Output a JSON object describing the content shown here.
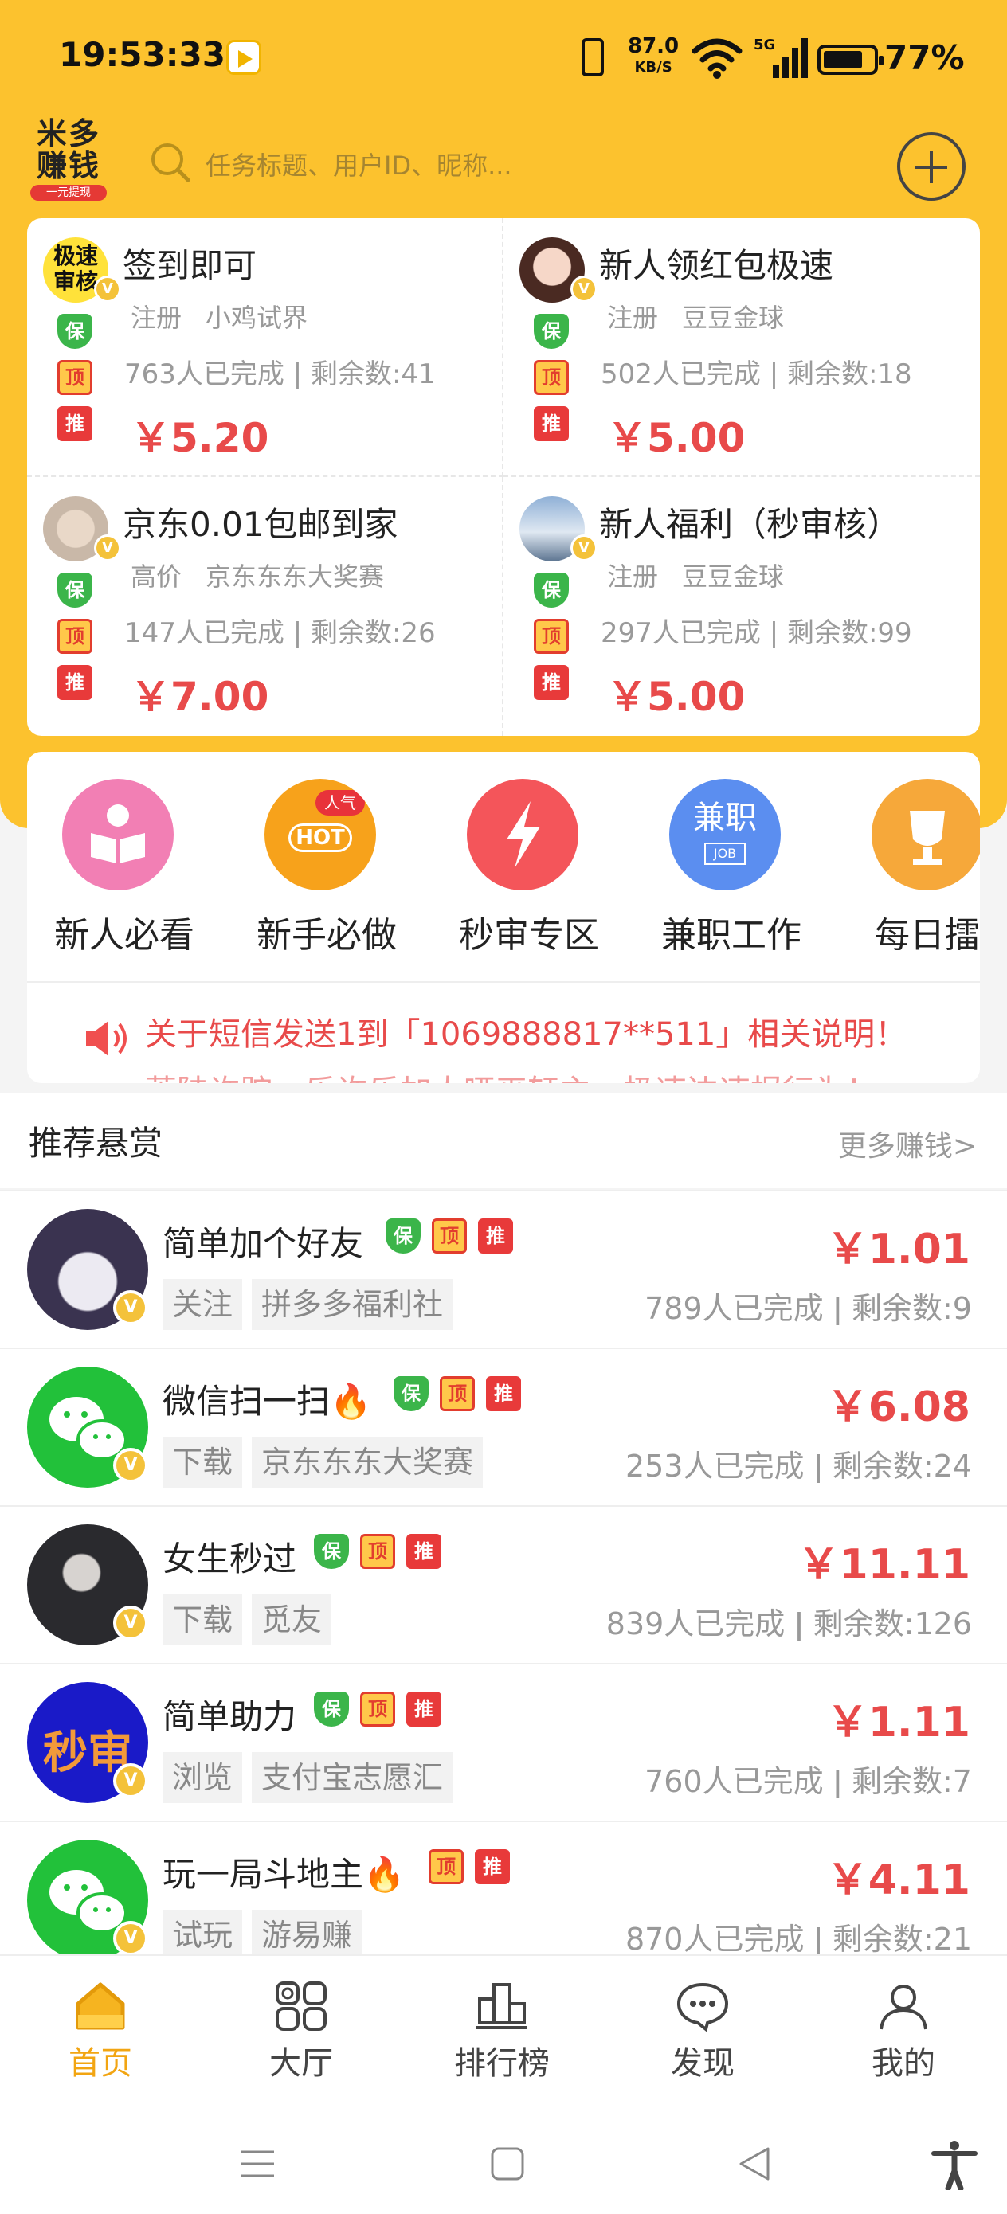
{
  "status": {
    "time": "19:53:33",
    "speed_top": "87.0",
    "speed_unit": "KB/S",
    "network": "5G",
    "battery": "77%"
  },
  "header": {
    "logo_line1": "米多",
    "logo_line2": "赚钱",
    "logo_sub": "一元提现",
    "search_placeholder": "任务标题、用户ID、昵称..."
  },
  "featured": [
    {
      "title": "签到即可",
      "tags": [
        "注册",
        "小鸡试界"
      ],
      "stats": "763人已完成 | 剩余数:41",
      "price": "￥5.20",
      "avatar_text": "极速审核"
    },
    {
      "title": "新人领红包极速",
      "tags": [
        "注册",
        "豆豆金球"
      ],
      "stats": "502人已完成 | 剩余数:18",
      "price": "￥5.00"
    },
    {
      "title": "京东0.01包邮到家",
      "tags": [
        "高价",
        "京东东东大奖赛"
      ],
      "stats": "147人已完成 | 剩余数:26",
      "price": "￥7.00"
    },
    {
      "title": "新人福利（秒审核）",
      "tags": [
        "注册",
        "豆豆金球"
      ],
      "stats": "297人已完成 | 剩余数:99",
      "price": "￥5.00"
    }
  ],
  "badge_labels": {
    "bao": "保",
    "ding": "顶",
    "tui": "推",
    "v": "V"
  },
  "quick": [
    {
      "label": "新人必看",
      "color": "#f27fb4"
    },
    {
      "label": "新手必做",
      "color": "#f7a21b",
      "icon_text": "HOT",
      "tag": "人气"
    },
    {
      "label": "秒审专区",
      "color": "#f4555a"
    },
    {
      "label": "兼职工作",
      "color": "#5b8ef0",
      "icon_text": "兼职",
      "icon_sub": "JOB"
    },
    {
      "label": "每日擂",
      "color": "#f6a83a"
    }
  ],
  "notice": {
    "line1": "关于短信发送1到「1069888817**511」相关说明！",
    "line2": "萧陆许踪，乐许乐加人哑巫轩主，极速边速报行为！"
  },
  "section": {
    "title": "推荐悬赏",
    "more": "更多赚钱>"
  },
  "tasks": [
    {
      "title": "简单加个好友",
      "fire": false,
      "tags": [
        "关注",
        "拼多多福利社"
      ],
      "stats": "789人已完成 ǀ 剩余数:9",
      "price": "￥1.01",
      "avatar": "anime"
    },
    {
      "title": "微信扫一扫🔥",
      "fire": true,
      "tags": [
        "下载",
        "京东东东大奖赛"
      ],
      "stats": "253人已完成 ǀ 剩余数:24",
      "price": "￥6.08",
      "avatar": "wechat"
    },
    {
      "title": "女生秒过",
      "fire": false,
      "tags": [
        "下载",
        "觅友"
      ],
      "stats": "839人已完成 ǀ 剩余数:126",
      "price": "￥11.11",
      "avatar": "photo"
    },
    {
      "title": "简单助力",
      "fire": false,
      "tags": [
        "浏览",
        "支付宝志愿汇"
      ],
      "stats": "760人已完成 ǀ 剩余数:7",
      "price": "￥1.11",
      "avatar": "miaoshen",
      "avatar_text": "秒审"
    },
    {
      "title": "玩一局斗地主🔥",
      "fire": true,
      "tags": [
        "试玩",
        "游易赚"
      ],
      "stats": "870人已完成 ǀ 剩余数:21",
      "price": "￥4.11",
      "avatar": "wechat"
    }
  ],
  "tabs": [
    {
      "label": "首页"
    },
    {
      "label": "大厅"
    },
    {
      "label": "排行榜"
    },
    {
      "label": "发现"
    },
    {
      "label": "我的"
    }
  ],
  "colors": {
    "brand": "#fcc22e",
    "price": "#e84a4a",
    "active_tab": "#f2a512"
  }
}
